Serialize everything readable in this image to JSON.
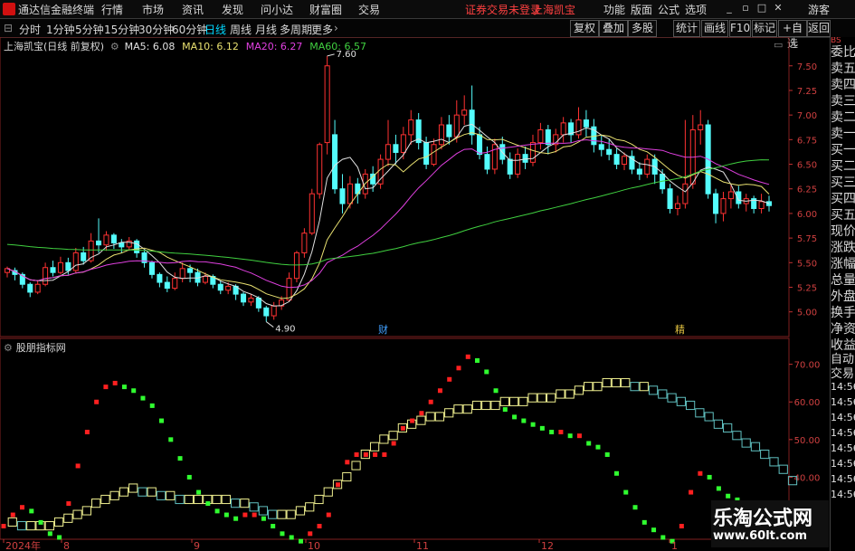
{
  "menubar": {
    "app_title": "通达信金融终端",
    "menus": [
      "行情",
      "市场",
      "资讯",
      "发现",
      "问小达",
      "财富圈",
      "交易"
    ],
    "notice": "证券交易未登录",
    "stock_name": "上海凯宝",
    "right_menus": [
      "功能",
      "版面",
      "公式",
      "选项"
    ],
    "guest": "游客"
  },
  "toolbar": {
    "periods": [
      "分时",
      "1分钟",
      "5分钟",
      "15分钟",
      "30分钟",
      "60分钟",
      "日线",
      "周线",
      "月线",
      "多周期",
      "更多"
    ],
    "active_period": "日线",
    "right_buttons": [
      "复权",
      "叠加",
      "多股",
      "统计",
      "画线",
      "F10",
      "标记",
      "+自选",
      "返回"
    ]
  },
  "main_chart": {
    "title": "上海凯宝(日线 前复权)",
    "ma_labels": [
      {
        "text": "MA5: 6.08",
        "color": "#e0e0e0"
      },
      {
        "text": "MA10: 6.12",
        "color": "#e8e070"
      },
      {
        "text": "MA20: 6.27",
        "color": "#e040e0"
      },
      {
        "text": "MA60: 6.57",
        "color": "#40d040"
      }
    ],
    "high_label": "7.60",
    "low_label": "4.90",
    "markers": [
      "财",
      "精"
    ]
  },
  "indicator": {
    "title": "股朋指标网"
  },
  "dates": [
    "2024年",
    "8",
    "9",
    "10",
    "11",
    "12",
    "1"
  ],
  "sidebar": {
    "top_small": "B\nS",
    "labels": [
      "委比",
      "卖五",
      "卖四",
      "卖三",
      "卖二",
      "卖一",
      "买一",
      "买二",
      "买三",
      "买四",
      "买五",
      "现价",
      "涨跌",
      "涨幅",
      "总量",
      "外盘",
      "换手",
      "净资",
      "收益"
    ],
    "auto_label": "自动",
    "trade_label": "交易",
    "times": [
      "14:56",
      "14:56",
      "14:56",
      "14:56",
      "14:56",
      "14:56",
      "14:56",
      "14:56"
    ]
  },
  "watermark": {
    "name": "乐淘公式网",
    "url": "www.60lt.com"
  },
  "chart_data": [
    {
      "type": "candlestick",
      "title": "上海凯宝(日线 前复权)",
      "y_ticks": [
        5.0,
        5.25,
        5.5,
        5.75,
        6.0,
        6.25,
        6.5,
        6.75,
        7.0,
        7.25,
        7.5
      ],
      "ylim": [
        4.85,
        7.7
      ],
      "up_color": "#ff3232",
      "down_color": "#54fcfc",
      "candles": [
        [
          5.4,
          5.44,
          5.35,
          5.46
        ],
        [
          5.42,
          5.38,
          5.32,
          5.45
        ],
        [
          5.38,
          5.28,
          5.24,
          5.4
        ],
        [
          5.28,
          5.2,
          5.15,
          5.3
        ],
        [
          5.2,
          5.28,
          5.18,
          5.32
        ],
        [
          5.28,
          5.45,
          5.26,
          5.5
        ],
        [
          5.45,
          5.4,
          5.36,
          5.52
        ],
        [
          5.4,
          5.5,
          5.38,
          5.56
        ],
        [
          5.5,
          5.42,
          5.38,
          5.55
        ],
        [
          5.42,
          5.6,
          5.4,
          5.65
        ],
        [
          5.6,
          5.52,
          5.48,
          5.66
        ],
        [
          5.52,
          5.72,
          5.5,
          5.8
        ],
        [
          5.72,
          5.68,
          5.6,
          5.95
        ],
        [
          5.68,
          5.78,
          5.62,
          5.82
        ],
        [
          5.78,
          5.7,
          5.64,
          5.8
        ],
        [
          5.7,
          5.66,
          5.6,
          5.74
        ],
        [
          5.66,
          5.72,
          5.62,
          5.76
        ],
        [
          5.72,
          5.6,
          5.55,
          5.74
        ],
        [
          5.6,
          5.5,
          5.45,
          5.62
        ],
        [
          5.5,
          5.38,
          5.34,
          5.52
        ],
        [
          5.38,
          5.3,
          5.25,
          5.4
        ],
        [
          5.3,
          5.24,
          5.2,
          5.36
        ],
        [
          5.24,
          5.34,
          5.22,
          5.4
        ],
        [
          5.34,
          5.44,
          5.3,
          5.5
        ],
        [
          5.44,
          5.4,
          5.3,
          5.48
        ],
        [
          5.4,
          5.3,
          5.26,
          5.44
        ],
        [
          5.3,
          5.36,
          5.28,
          5.4
        ],
        [
          5.36,
          5.28,
          5.24,
          5.38
        ],
        [
          5.28,
          5.22,
          5.18,
          5.32
        ],
        [
          5.22,
          5.26,
          5.18,
          5.3
        ],
        [
          5.26,
          5.18,
          5.12,
          5.28
        ],
        [
          5.18,
          5.1,
          5.06,
          5.2
        ],
        [
          5.1,
          5.14,
          5.06,
          5.18
        ],
        [
          5.14,
          5.04,
          5.0,
          5.16
        ],
        [
          5.04,
          4.96,
          4.9,
          5.06
        ],
        [
          4.96,
          5.06,
          4.92,
          5.1
        ],
        [
          5.06,
          5.12,
          5.02,
          5.16
        ],
        [
          5.12,
          5.34,
          5.1,
          5.4
        ],
        [
          5.34,
          5.6,
          5.3,
          5.62
        ],
        [
          5.6,
          5.8,
          5.55,
          5.85
        ],
        [
          5.8,
          6.2,
          5.78,
          6.25
        ],
        [
          6.2,
          6.7,
          6.15,
          6.72
        ],
        [
          6.72,
          7.5,
          6.6,
          7.6
        ],
        [
          6.8,
          6.25,
          6.2,
          6.95
        ],
        [
          6.25,
          6.1,
          6.0,
          6.4
        ],
        [
          6.1,
          6.3,
          6.05,
          6.38
        ],
        [
          6.3,
          6.2,
          6.1,
          6.36
        ],
        [
          6.2,
          6.4,
          6.15,
          6.45
        ],
        [
          6.4,
          6.3,
          6.22,
          6.48
        ],
        [
          6.3,
          6.55,
          6.25,
          6.6
        ],
        [
          6.55,
          6.7,
          6.48,
          6.95
        ],
        [
          6.7,
          6.62,
          6.5,
          6.8
        ],
        [
          6.62,
          6.8,
          6.55,
          6.88
        ],
        [
          6.8,
          6.95,
          6.7,
          7.05
        ],
        [
          6.95,
          6.72,
          6.65,
          7.02
        ],
        [
          6.72,
          6.5,
          6.45,
          6.78
        ],
        [
          6.5,
          6.7,
          6.48,
          6.76
        ],
        [
          6.7,
          6.9,
          6.65,
          6.98
        ],
        [
          6.9,
          6.78,
          6.7,
          7.0
        ],
        [
          6.78,
          7.0,
          6.72,
          7.15
        ],
        [
          7.0,
          7.05,
          6.9,
          7.2
        ],
        [
          7.05,
          6.8,
          6.7,
          7.3
        ],
        [
          6.8,
          6.6,
          6.55,
          6.88
        ],
        [
          6.6,
          6.45,
          6.4,
          6.68
        ],
        [
          6.45,
          6.7,
          6.4,
          6.76
        ],
        [
          6.7,
          6.55,
          6.5,
          6.78
        ],
        [
          6.55,
          6.4,
          6.35,
          6.62
        ],
        [
          6.4,
          6.6,
          6.36,
          6.66
        ],
        [
          6.6,
          6.52,
          6.45,
          6.68
        ],
        [
          6.52,
          6.72,
          6.48,
          6.8
        ],
        [
          6.72,
          6.85,
          6.65,
          6.92
        ],
        [
          6.85,
          6.7,
          6.6,
          6.9
        ],
        [
          6.7,
          6.8,
          6.62,
          6.86
        ],
        [
          6.8,
          6.92,
          6.72,
          6.98
        ],
        [
          6.92,
          6.8,
          6.72,
          6.96
        ],
        [
          6.8,
          6.95,
          6.76,
          7.08
        ],
        [
          6.95,
          6.88,
          6.78,
          7.05
        ],
        [
          6.88,
          6.7,
          6.62,
          6.96
        ],
        [
          6.7,
          6.65,
          6.58,
          6.8
        ],
        [
          6.65,
          6.6,
          6.54,
          6.75
        ],
        [
          6.6,
          6.5,
          6.45,
          6.66
        ],
        [
          6.5,
          6.58,
          6.44,
          6.62
        ],
        [
          6.58,
          6.45,
          6.4,
          6.64
        ],
        [
          6.45,
          6.4,
          6.34,
          6.52
        ],
        [
          6.4,
          6.55,
          6.36,
          6.6
        ],
        [
          6.55,
          6.4,
          6.3,
          6.6
        ],
        [
          6.4,
          6.25,
          6.2,
          6.45
        ],
        [
          6.25,
          6.05,
          6.0,
          6.3
        ],
        [
          6.05,
          6.1,
          5.98,
          6.18
        ],
        [
          6.1,
          6.3,
          6.05,
          6.95
        ],
        [
          6.3,
          6.85,
          6.25,
          7.0
        ],
        [
          6.85,
          6.9,
          6.7,
          7.05
        ],
        [
          6.9,
          6.2,
          6.15,
          6.95
        ],
        [
          6.2,
          6.0,
          5.9,
          6.25
        ],
        [
          6.0,
          6.15,
          5.92,
          6.22
        ],
        [
          6.15,
          6.22,
          6.05,
          6.3
        ],
        [
          6.22,
          6.1,
          6.05,
          6.28
        ],
        [
          6.1,
          6.15,
          6.02,
          6.2
        ],
        [
          6.15,
          6.05,
          6.0,
          6.18
        ],
        [
          6.05,
          6.12,
          6.0,
          6.2
        ],
        [
          6.12,
          6.08,
          6.02,
          6.18
        ]
      ]
    },
    {
      "type": "line",
      "title": "股朋指标网",
      "y_ticks": [
        30,
        40,
        50,
        60,
        70
      ],
      "ylim": [
        24,
        74
      ],
      "series": [
        {
          "values": [
            27,
            30,
            32,
            31,
            28,
            25,
            24,
            33,
            43,
            52,
            60,
            64,
            65,
            64,
            63,
            61,
            59,
            55,
            50,
            45,
            40,
            36,
            33,
            31,
            30,
            29,
            30,
            30,
            29,
            27,
            25,
            24,
            23,
            25,
            27,
            30,
            38,
            44,
            46,
            46,
            46,
            46,
            49,
            53,
            55,
            57,
            60,
            63,
            66,
            69,
            72,
            71,
            68,
            63,
            58,
            56,
            55,
            54,
            53,
            52,
            52,
            51,
            51,
            49,
            48,
            46,
            41,
            36,
            32,
            28,
            26,
            24,
            23,
            27,
            36,
            41,
            40,
            37,
            35,
            34,
            33,
            32,
            31,
            30
          ]
        },
        {
          "values": [
            27,
            27,
            26,
            26,
            26,
            26,
            27,
            28,
            29,
            30,
            32,
            33,
            34,
            35,
            36,
            35,
            35,
            34,
            34,
            33,
            33,
            33,
            33,
            33,
            33,
            32,
            32,
            31,
            30,
            29,
            29,
            29,
            30,
            31,
            33,
            35,
            37,
            39,
            42,
            45,
            47,
            49,
            50,
            52,
            53,
            54,
            55,
            55,
            56,
            57,
            57,
            58,
            58,
            58,
            59,
            59,
            59,
            60,
            60,
            60,
            61,
            61,
            62,
            63,
            63,
            64,
            64,
            64,
            63,
            63,
            62,
            61,
            60,
            59,
            58,
            56,
            55,
            53,
            52,
            50,
            48,
            47,
            45,
            43,
            41,
            38
          ]
        }
      ]
    }
  ]
}
